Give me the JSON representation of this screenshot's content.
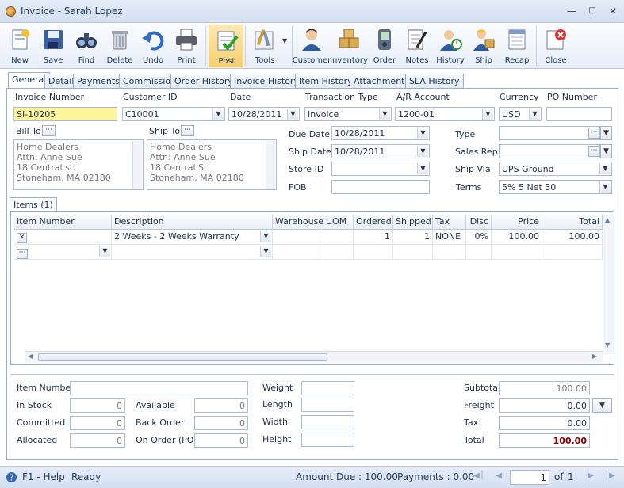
{
  "window": {
    "title": "Invoice - Sarah Lopez"
  },
  "toolbar": [
    {
      "name": "new",
      "label": "New"
    },
    {
      "name": "save",
      "label": "Save"
    },
    {
      "name": "find",
      "label": "Find"
    },
    {
      "name": "delete",
      "label": "Delete"
    },
    {
      "name": "undo",
      "label": "Undo"
    },
    {
      "name": "print",
      "label": "Print"
    },
    {
      "name": "post",
      "label": "Post"
    },
    {
      "name": "tools",
      "label": "Tools"
    },
    {
      "name": "customer",
      "label": "Customer"
    },
    {
      "name": "inventory",
      "label": "Inventory"
    },
    {
      "name": "order",
      "label": "Order"
    },
    {
      "name": "notes",
      "label": "Notes"
    },
    {
      "name": "history",
      "label": "History"
    },
    {
      "name": "ship",
      "label": "Ship"
    },
    {
      "name": "recap",
      "label": "Recap"
    },
    {
      "name": "close",
      "label": "Close"
    }
  ],
  "tabs": [
    "General",
    "Detail",
    "Payments",
    "Commission",
    "Order History",
    "Invoice History",
    "Item History",
    "Attachments",
    "SLA History"
  ],
  "header": {
    "invoice_number_label": "Invoice Number",
    "invoice_number": "SI-10205",
    "customer_id_label": "Customer ID",
    "customer_id": "C10001",
    "date_label": "Date",
    "date": "10/28/2011",
    "transaction_type_label": "Transaction Type",
    "transaction_type": "Invoice",
    "ar_account_label": "A/R Account",
    "ar_account": "1200-01",
    "currency_label": "Currency",
    "currency": "USD",
    "po_number_label": "PO Number",
    "po_number": ""
  },
  "bill_to": {
    "label": "Bill To",
    "lines": [
      "Home Dealers",
      "Attn: Anne Sue",
      "18 Central st.",
      "Stoneham, MA 02180"
    ]
  },
  "ship_to": {
    "label": "Ship To",
    "lines": [
      "Home Dealers",
      "Attn: Anne Sue",
      "18 Central St",
      "Stoneham, MA 02180"
    ]
  },
  "details": {
    "due_date_label": "Due Date",
    "due_date": "10/28/2011",
    "ship_date_label": "Ship Date",
    "ship_date": "10/28/2011",
    "store_id_label": "Store ID",
    "store_id": "",
    "fob_label": "FOB",
    "fob": "",
    "type_label": "Type",
    "type": "",
    "sales_rep_label": "Sales Rep",
    "sales_rep": "",
    "ship_via_label": "Ship Via",
    "ship_via": "UPS Ground",
    "terms_label": "Terms",
    "terms": "5% 5 Net 30"
  },
  "items": {
    "tab_label": "Items (1)",
    "columns": [
      "Item Number",
      "Description",
      "Warehouse",
      "UOM",
      "Ordered",
      "Shipped",
      "Tax",
      "Disc",
      "Price",
      "Total"
    ],
    "rows": [
      {
        "item_number": "",
        "description": "2 Weeks - 2 Weeks Warranty",
        "warehouse": "",
        "uom": "",
        "ordered": "1",
        "shipped": "1",
        "tax": "NONE",
        "disc": "0%",
        "price": "100.00",
        "total": "100.00"
      }
    ]
  },
  "stock": {
    "item_number_label": "Item Number",
    "item_number": "",
    "in_stock_label": "In Stock",
    "in_stock": "0",
    "committed_label": "Committed",
    "committed": "0",
    "allocated_label": "Allocated",
    "allocated": "0",
    "available_label": "Available",
    "available": "0",
    "back_order_label": "Back Order",
    "back_order": "0",
    "on_order_label": "On Order (PO)",
    "on_order": "0"
  },
  "dimensions": {
    "weight_label": "Weight",
    "weight": "",
    "length_label": "Length",
    "length": "",
    "width_label": "Width",
    "width": "",
    "height_label": "Height",
    "height": ""
  },
  "totals": {
    "subtotal_label": "Subtotal",
    "subtotal": "100.00",
    "freight_label": "Freight",
    "freight": "0.00",
    "tax_label": "Tax",
    "tax": "0.00",
    "total_label": "Total",
    "total": "100.00"
  },
  "status": {
    "help": "F1 - Help",
    "state": "Ready",
    "amount_due": "Amount Due : 100.00",
    "payments": "Payments : 0.00",
    "page": "1",
    "of": "of",
    "page_total": "1"
  },
  "colors": {
    "highlight": "#fff59a",
    "accent": "#d6a63c",
    "total_text": "#8b0000"
  }
}
